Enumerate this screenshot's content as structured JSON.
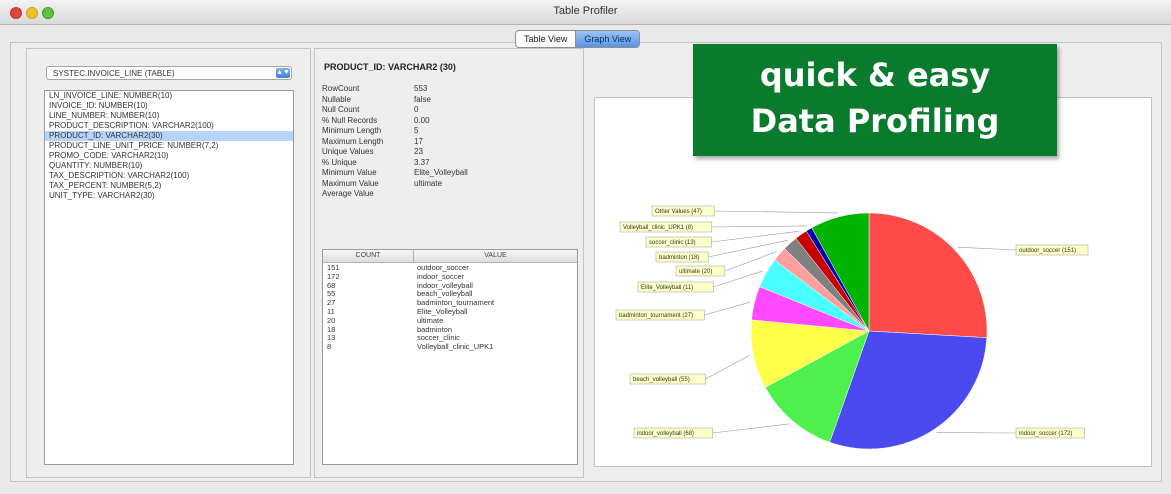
{
  "window": {
    "title": "Table Profiler"
  },
  "view_toggle": {
    "table_view": "Table View",
    "graph_view": "Graph View"
  },
  "table_select": {
    "value": "SYSTEC.INVOICE_LINE (TABLE)"
  },
  "columns": [
    "LN_INVOICE_LINE: NUMBER(10)",
    "INVOICE_ID: NUMBER(10)",
    "LINE_NUMBER: NUMBER(10)",
    "PRODUCT_DESCRIPTION: VARCHAR2(100)",
    "PRODUCT_ID: VARCHAR2(30)",
    "PRODUCT_LINE_UNIT_PRICE: NUMBER(7,2)",
    "PROMO_CODE: VARCHAR2(10)",
    "QUANTITY: NUMBER(10)",
    "TAX_DESCRIPTION: VARCHAR2(100)",
    "TAX_PERCENT: NUMBER(5,2)",
    "UNIT_TYPE: VARCHAR2(30)"
  ],
  "selected_column_index": 4,
  "profile": {
    "header": "PRODUCT_ID: VARCHAR2 (30)",
    "stats": [
      {
        "key": "RowCount",
        "value": "553"
      },
      {
        "key": "Nullable",
        "value": "false"
      },
      {
        "key": "Null Count",
        "value": "0"
      },
      {
        "key": "% Null Records",
        "value": "0.00"
      },
      {
        "key": "Minimum Length",
        "value": "5"
      },
      {
        "key": "Maximum Length",
        "value": "17"
      },
      {
        "key": "Unique Values",
        "value": "23"
      },
      {
        "key": "% Unique",
        "value": "3.37"
      },
      {
        "key": "Minimum Value",
        "value": "Elite_Volleyball"
      },
      {
        "key": "Maximum Value",
        "value": "ultimate"
      },
      {
        "key": "Average Value",
        "value": ""
      }
    ]
  },
  "values_table": {
    "headers": [
      "COUNT",
      "VALUE"
    ],
    "rows": [
      {
        "count": "151",
        "value": "outdoor_soccer"
      },
      {
        "count": "172",
        "value": "indoor_soccer"
      },
      {
        "count": "68",
        "value": "indoor_volleyball"
      },
      {
        "count": "55",
        "value": "beach_volleyball"
      },
      {
        "count": "27",
        "value": "badminton_tournament"
      },
      {
        "count": "11",
        "value": "Elite_Volleyball"
      },
      {
        "count": "20",
        "value": "ultimate"
      },
      {
        "count": "18",
        "value": "badminton"
      },
      {
        "count": "13",
        "value": "soccer_clinic"
      },
      {
        "count": "8",
        "value": "Volleyball_clinic_UPK1"
      }
    ]
  },
  "promo": {
    "line1": "quick & easy",
    "line2": "Data Profiling"
  },
  "chart_data": {
    "type": "pie",
    "slices": [
      {
        "label": "outdoor_soccer (151)",
        "value": 151,
        "color": "#ff4a4a"
      },
      {
        "label": "indoor_soccer (172)",
        "value": 172,
        "color": "#4a4af0"
      },
      {
        "label": "indoor_volleyball (68)",
        "value": 68,
        "color": "#4ef04e"
      },
      {
        "label": "beach_volleyball (55)",
        "value": 55,
        "color": "#ffff4a"
      },
      {
        "label": "badminton_tournament (27)",
        "value": 27,
        "color": "#ff4aff"
      },
      {
        "label": "Elite_Volleyball (11)",
        "value": 24,
        "color": "#4affff"
      },
      {
        "label": "ultimate (20)",
        "value": 12,
        "color": "#ffa0a0"
      },
      {
        "label": "badminton (18)",
        "value": 12,
        "color": "#808080"
      },
      {
        "label": "soccer_clinic (13)",
        "value": 10,
        "color": "#c80000"
      },
      {
        "label": "Volleyball_clinic_UPK1 (8)",
        "value": 5,
        "color": "#0000b0"
      },
      {
        "label": "Other Values (47)",
        "value": 47,
        "color": "#00b400"
      }
    ]
  }
}
